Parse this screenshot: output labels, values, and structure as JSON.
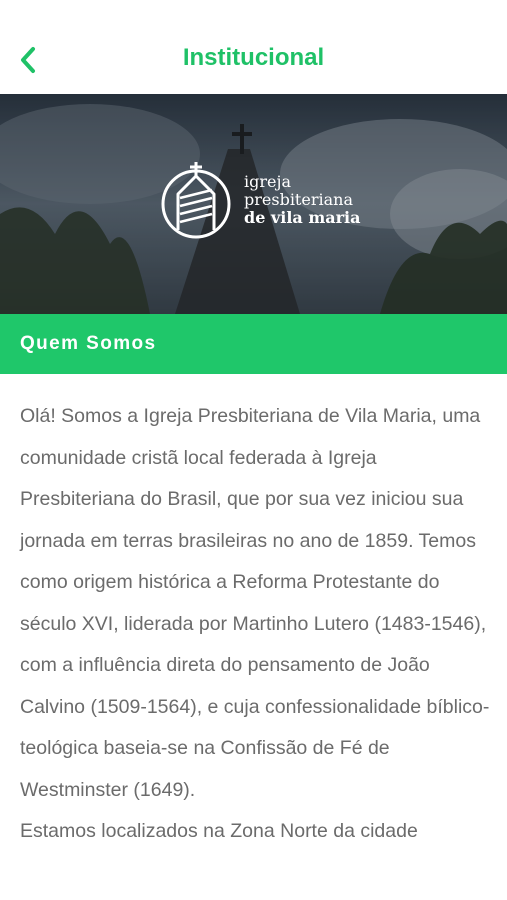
{
  "navbar": {
    "title": "Institucional",
    "back_icon": "chevron-left-icon",
    "accent_color": "#1fc167"
  },
  "hero": {
    "logo_icon": "church-logo-icon",
    "logo_line1": "igreja",
    "logo_line2": "presbiteriana",
    "logo_line3": "de vila maria"
  },
  "section": {
    "title": "Quem Somos",
    "bar_color": "#1fc76a"
  },
  "content": {
    "paragraph1": "Olá! Somos a Igreja Presbiteriana de Vila Maria, uma comunidade cristã local federada à Igreja Presbiteriana do Brasil, que por sua vez iniciou sua jornada em terras brasileiras no ano de 1859. Temos como origem histórica a Reforma Protestante do século XVI, liderada por Martinho Lutero (1483-1546), com a influência direta do pensamento de João Calvino (1509-1564), e cuja confessionalidade bíblico-teológica baseia-se na Confissão de Fé de Westminster (1649).",
    "paragraph2": "Estamos localizados na Zona Norte da cidade"
  }
}
